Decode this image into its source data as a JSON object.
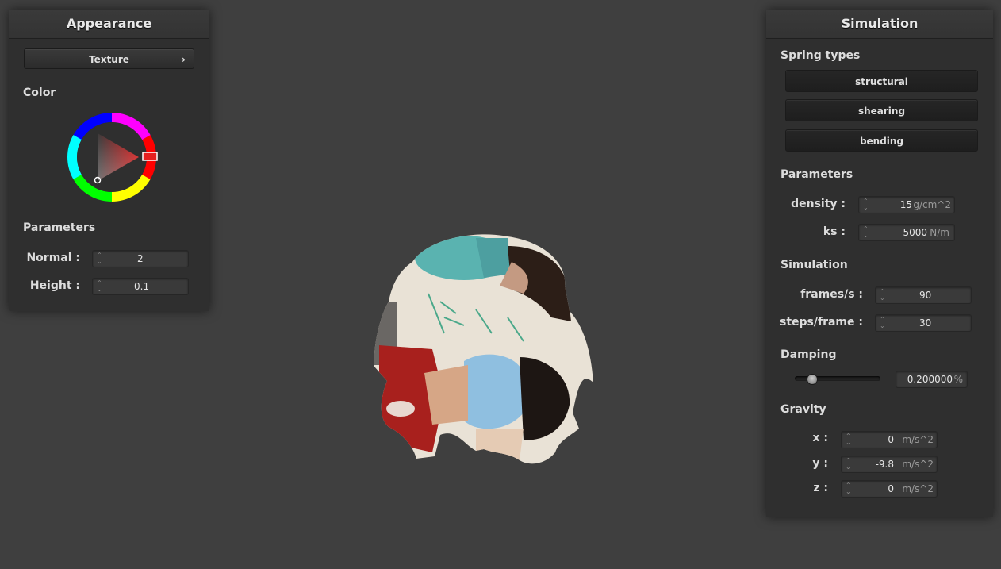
{
  "appearance": {
    "title": "Appearance",
    "texture_button": "Texture",
    "color_label": "Color",
    "color_value": "#c01010",
    "parameters_label": "Parameters",
    "params": [
      {
        "label": "Normal :",
        "value": "2"
      },
      {
        "label": "Height :",
        "value": "0.1"
      }
    ]
  },
  "simulation": {
    "title": "Simulation",
    "spring_types_label": "Spring types",
    "spring_buttons": [
      "structural",
      "shearing",
      "bending"
    ],
    "parameters_label": "Parameters",
    "density": {
      "label": "density :",
      "value": "15",
      "unit": "g/cm^2"
    },
    "ks": {
      "label": "ks :",
      "value": "5000",
      "unit": "N/m"
    },
    "simulation_label": "Simulation",
    "frames": {
      "label": "frames/s :",
      "value": "90"
    },
    "steps": {
      "label": "steps/frame :",
      "value": "30"
    },
    "damping_label": "Damping",
    "damping": {
      "value": "0.200000",
      "unit": "%",
      "slider_fraction": 0.2
    },
    "gravity_label": "Gravity",
    "gravity": [
      {
        "label": "x :",
        "value": "0",
        "unit": "m/s^2"
      },
      {
        "label": "y :",
        "value": "-9.8",
        "unit": "m/s^2"
      },
      {
        "label": "z :",
        "value": "0",
        "unit": "m/s^2"
      }
    ]
  }
}
